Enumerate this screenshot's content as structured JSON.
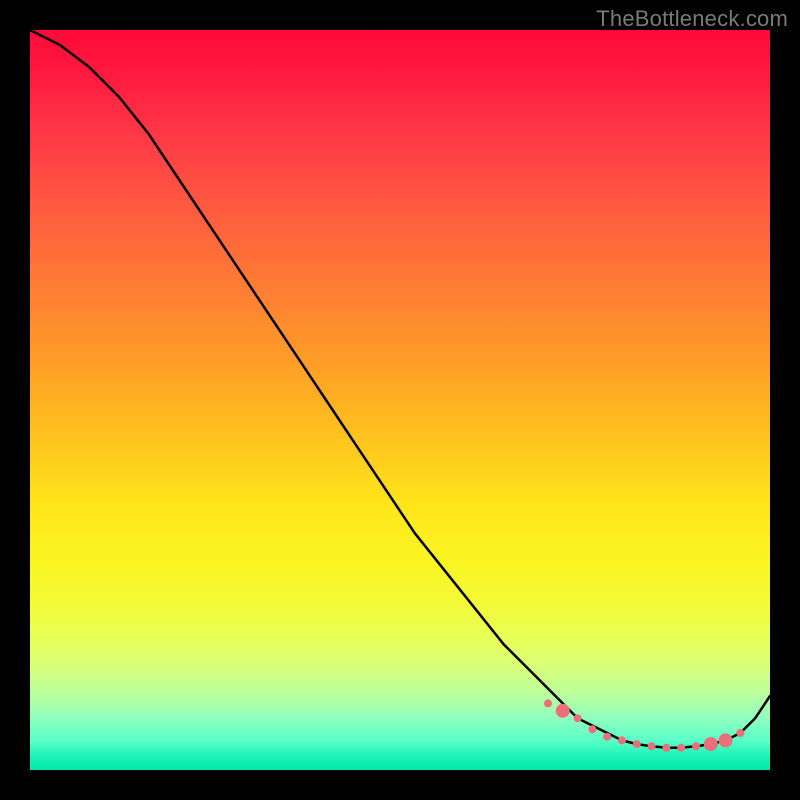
{
  "watermark": "TheBottleneck.com",
  "chart_data": {
    "type": "line",
    "title": "",
    "xlabel": "",
    "ylabel": "",
    "xlim": [
      0,
      100
    ],
    "ylim": [
      0,
      100
    ],
    "grid": false,
    "series": [
      {
        "name": "curve",
        "color": "#000000",
        "x": [
          0,
          4,
          8,
          12,
          16,
          20,
          24,
          28,
          32,
          36,
          40,
          44,
          48,
          52,
          56,
          60,
          64,
          68,
          72,
          74,
          76,
          78,
          80,
          82,
          84,
          86,
          88,
          90,
          92,
          94,
          96,
          98,
          100
        ],
        "values": [
          100,
          98,
          95,
          91,
          86,
          80,
          74,
          68,
          62,
          56,
          50,
          44,
          38,
          32,
          27,
          22,
          17,
          13,
          9,
          7,
          6,
          5,
          4,
          3.5,
          3.2,
          3,
          3,
          3.2,
          3.5,
          4,
          5,
          7,
          10
        ]
      }
    ],
    "markers": {
      "color": "#eb6f7a",
      "radius_small": 4,
      "radius_big": 7,
      "points": [
        {
          "x": 70,
          "y": 9,
          "r": "small"
        },
        {
          "x": 72,
          "y": 8,
          "r": "big"
        },
        {
          "x": 74,
          "y": 7,
          "r": "small"
        },
        {
          "x": 76,
          "y": 5.5,
          "r": "small"
        },
        {
          "x": 78,
          "y": 4.5,
          "r": "small"
        },
        {
          "x": 80,
          "y": 4,
          "r": "small"
        },
        {
          "x": 82,
          "y": 3.5,
          "r": "small"
        },
        {
          "x": 84,
          "y": 3.2,
          "r": "small"
        },
        {
          "x": 86,
          "y": 3,
          "r": "small"
        },
        {
          "x": 88,
          "y": 3,
          "r": "small"
        },
        {
          "x": 90,
          "y": 3.2,
          "r": "small"
        },
        {
          "x": 92,
          "y": 3.5,
          "r": "big"
        },
        {
          "x": 94,
          "y": 4,
          "r": "big"
        },
        {
          "x": 96,
          "y": 5,
          "r": "small"
        }
      ]
    }
  }
}
